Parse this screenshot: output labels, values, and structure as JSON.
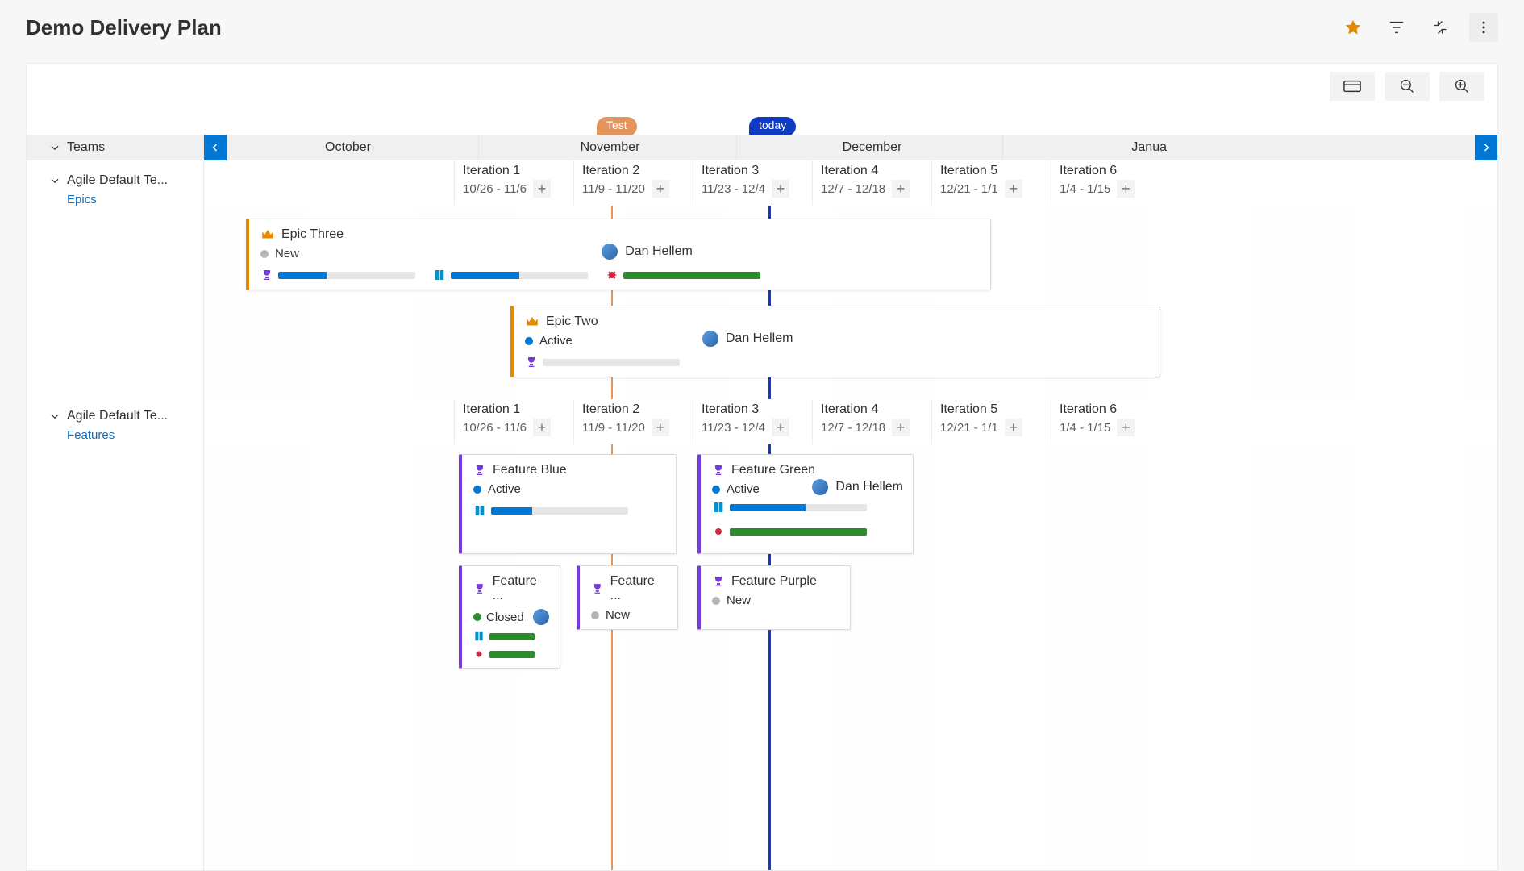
{
  "page": {
    "title": "Demo Delivery Plan"
  },
  "markers": {
    "test": "Test",
    "today": "today"
  },
  "teams_header": "Teams",
  "months": [
    "October",
    "November",
    "December",
    "Janua"
  ],
  "iterations": [
    {
      "title": "Iteration 1",
      "dates": "10/26 - 11/6"
    },
    {
      "title": "Iteration 2",
      "dates": "11/9 - 11/20"
    },
    {
      "title": "Iteration 3",
      "dates": "11/23 - 12/4"
    },
    {
      "title": "Iteration 4",
      "dates": "12/7 - 12/18"
    },
    {
      "title": "Iteration 5",
      "dates": "12/21 - 1/1"
    },
    {
      "title": "Iteration 6",
      "dates": "1/4 - 1/15"
    }
  ],
  "teams": [
    {
      "name": "Agile Default Te...",
      "backlog": "Epics"
    },
    {
      "name": "Agile Default Te...",
      "backlog": "Features"
    }
  ],
  "cards": {
    "epic3": {
      "title": "Epic Three",
      "status": "New",
      "assignee": "Dan Hellem",
      "rollups": [
        {
          "icon": "trophy",
          "pct": 35,
          "color": "blue"
        },
        {
          "icon": "book",
          "pct": 50,
          "color": "blue"
        },
        {
          "icon": "bug",
          "pct": 100,
          "color": "green"
        }
      ]
    },
    "epic2": {
      "title": "Epic Two",
      "status": "Active",
      "assignee": "Dan Hellem",
      "rollups": [
        {
          "icon": "trophy",
          "pct": 0,
          "color": "blue"
        }
      ]
    },
    "fblue": {
      "title": "Feature Blue",
      "status": "Active",
      "rollups": [
        {
          "icon": "book",
          "pct": 30,
          "color": "blue"
        }
      ]
    },
    "fgreen": {
      "title": "Feature Green",
      "status": "Active",
      "assignee": "Dan Hellem",
      "rollups": [
        {
          "icon": "book",
          "pct": 55,
          "color": "blue"
        },
        {
          "icon": "bug",
          "pct": 100,
          "color": "green"
        }
      ]
    },
    "fclosed": {
      "title": "Feature ...",
      "status": "Closed",
      "rollups": [
        {
          "icon": "book",
          "pct": 100,
          "color": "green"
        },
        {
          "icon": "bug",
          "pct": 100,
          "color": "green"
        }
      ]
    },
    "fnew1": {
      "title": "Feature ...",
      "status": "New"
    },
    "fpurple": {
      "title": "Feature Purple",
      "status": "New"
    }
  },
  "colors": {
    "epic": "#E48900",
    "feature": "#773ADC",
    "accent": "#0078D4"
  }
}
